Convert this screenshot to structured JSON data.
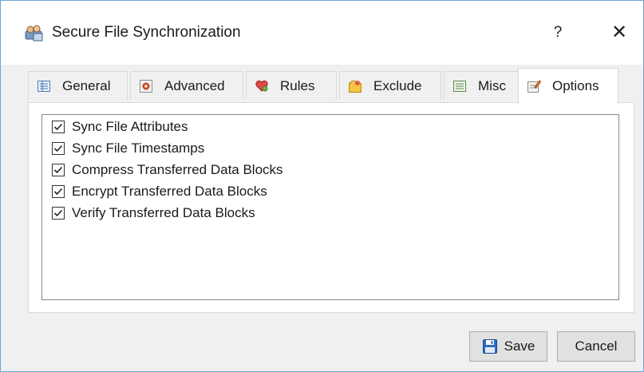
{
  "window": {
    "title": "Secure File Synchronization",
    "help_label": "?",
    "close_label": "✕"
  },
  "tabs": [
    {
      "label": "General",
      "icon": "general-icon",
      "active": false
    },
    {
      "label": "Advanced",
      "icon": "advanced-icon",
      "active": false
    },
    {
      "label": "Rules",
      "icon": "rules-icon",
      "active": false
    },
    {
      "label": "Exclude",
      "icon": "exclude-icon",
      "active": false
    },
    {
      "label": "Misc",
      "icon": "misc-icon",
      "active": false
    },
    {
      "label": "Options",
      "icon": "options-icon",
      "active": true
    }
  ],
  "options": [
    {
      "label": "Sync File Attributes",
      "checked": true
    },
    {
      "label": "Sync File Timestamps",
      "checked": true
    },
    {
      "label": "Compress Transferred Data Blocks",
      "checked": true
    },
    {
      "label": "Encrypt Transferred Data Blocks",
      "checked": true
    },
    {
      "label": "Verify Transferred Data Blocks",
      "checked": true
    }
  ],
  "buttons": {
    "save_label": "Save",
    "cancel_label": "Cancel"
  },
  "colors": {
    "window_border": "#6fa3d6",
    "accent": "#2b6cc4"
  }
}
